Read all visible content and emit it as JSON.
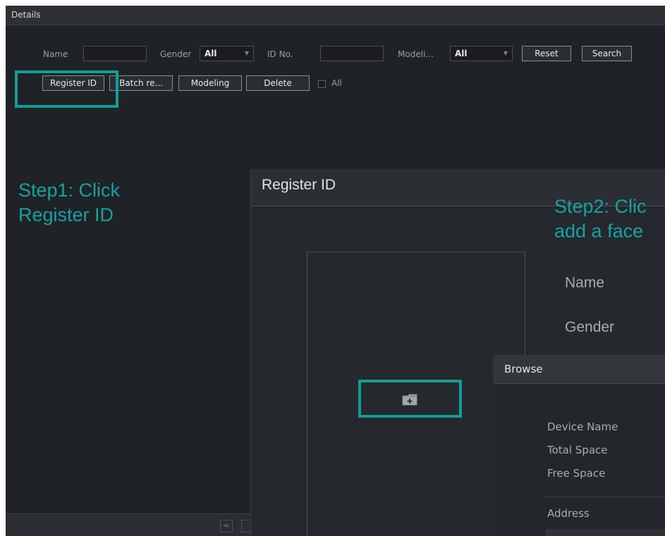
{
  "window": {
    "title": "Details"
  },
  "filters": {
    "name_label": "Name",
    "name_value": "",
    "gender_label": "Gender",
    "gender_value": "All",
    "id_label": "ID No.",
    "id_value": "",
    "modeling_label": "Modeli...",
    "modeling_value": "All",
    "reset_label": "Reset",
    "search_label": "Search"
  },
  "toolbar": {
    "register_label": "Register ID",
    "batch_label": "Batch re...",
    "modeling_label": "Modeling",
    "delete_label": "Delete",
    "all_label": "All"
  },
  "annotations": {
    "step1_line1": "Step1: Click",
    "step1_line2": "Register ID",
    "step2_line1": "Step2: Clic",
    "step2_line2": "add a face"
  },
  "register_dialog": {
    "title": "Register ID",
    "name_label": "Name",
    "gender_label": "Gender",
    "add_icon": "add-folder-icon"
  },
  "browse_dialog": {
    "title": "Browse",
    "device_name_label": "Device Name",
    "total_space_label": "Total Space",
    "free_space_label": "Free Space",
    "address_label": "Address"
  },
  "colors": {
    "highlight": "#139c9c",
    "annotation_text": "#14a3a3",
    "background": "#1f2226"
  }
}
